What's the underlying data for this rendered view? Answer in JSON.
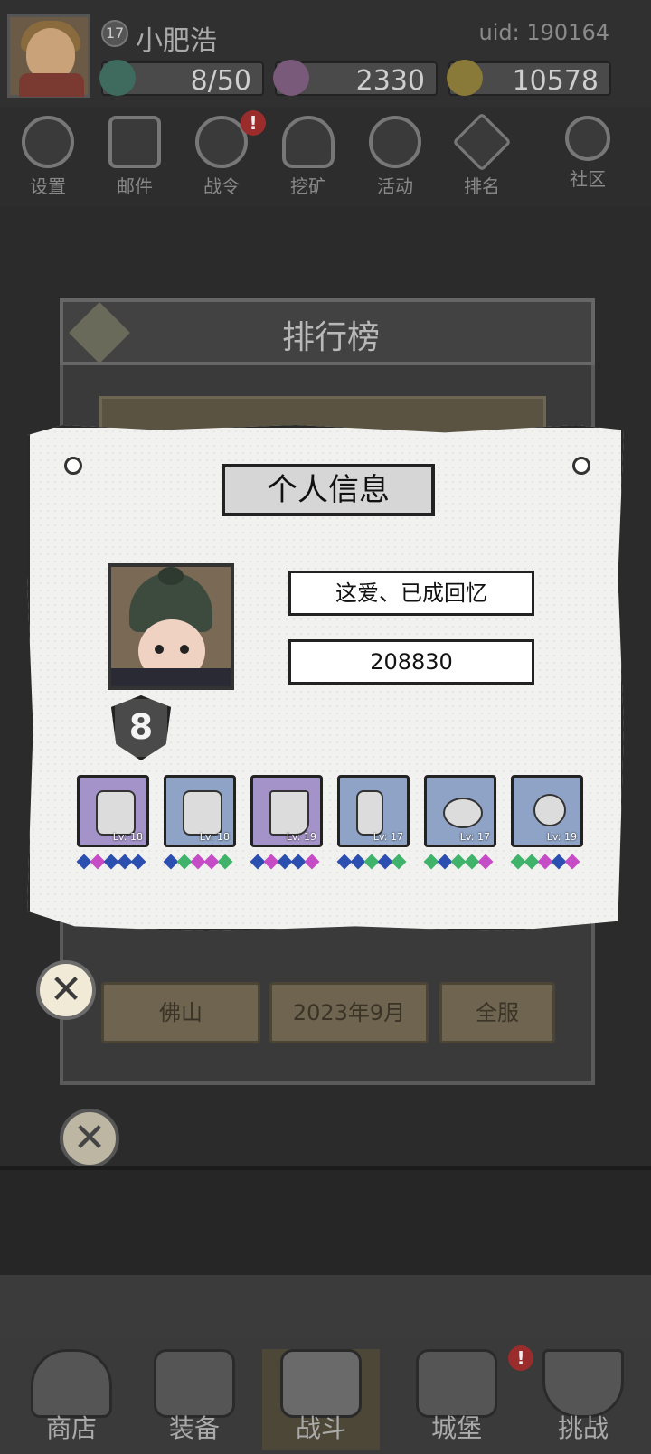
{
  "top": {
    "level": "17",
    "username": "小肥浩",
    "uid": "uid: 190164",
    "energy": "8/50",
    "diamonds": "2330",
    "gold": "10578"
  },
  "nav": {
    "settings": "设置",
    "mail": "邮件",
    "battle_pass": "战令",
    "mining": "挖矿",
    "events": "活动",
    "ranking": "排名",
    "community": "社区",
    "badge": "!"
  },
  "ranking_panel": {
    "title": "排行榜",
    "filters": [
      "佛山",
      "2023年9月",
      "全服"
    ]
  },
  "info_card": {
    "title": "个人信息",
    "name": "这爱、已成回忆",
    "score": "208830",
    "rank_level": "8",
    "equipment": [
      {
        "name": "helmet-icon",
        "level": "Lv: 18",
        "color": "purple",
        "gems": [
          "#2b4fb0",
          "#c64bc6",
          "#2b4fb0",
          "#2b4fb0",
          "#2b4fb0"
        ]
      },
      {
        "name": "armor-icon",
        "level": "Lv: 18",
        "color": "blue",
        "gems": [
          "#2b4fb0",
          "#3fb36a",
          "#c64bc6",
          "#c64bc6",
          "#3fb36a"
        ]
      },
      {
        "name": "boots-icon",
        "level": "Lv: 19",
        "color": "purple",
        "gems": [
          "#2b4fb0",
          "#c64bc6",
          "#2b4fb0",
          "#2b4fb0",
          "#c64bc6"
        ]
      },
      {
        "name": "gloves-icon",
        "level": "Lv: 17",
        "color": "blue",
        "gems": [
          "#2b4fb0",
          "#2b4fb0",
          "#3fb36a",
          "#2b4fb0",
          "#3fb36a"
        ]
      },
      {
        "name": "ring-icon",
        "level": "Lv: 17",
        "color": "blue",
        "gems": [
          "#3fb36a",
          "#2b4fb0",
          "#3fb36a",
          "#3fb36a",
          "#c64bc6"
        ]
      },
      {
        "name": "necklace-icon",
        "level": "Lv: 19",
        "color": "blue",
        "gems": [
          "#3fb36a",
          "#3fb36a",
          "#c64bc6",
          "#2b4fb0",
          "#c64bc6"
        ]
      }
    ]
  },
  "close_symbol": "✕",
  "bottom_nav": {
    "shop": "商店",
    "equipment": "装备",
    "battle": "战斗",
    "castle": "城堡",
    "challenge": "挑战"
  }
}
